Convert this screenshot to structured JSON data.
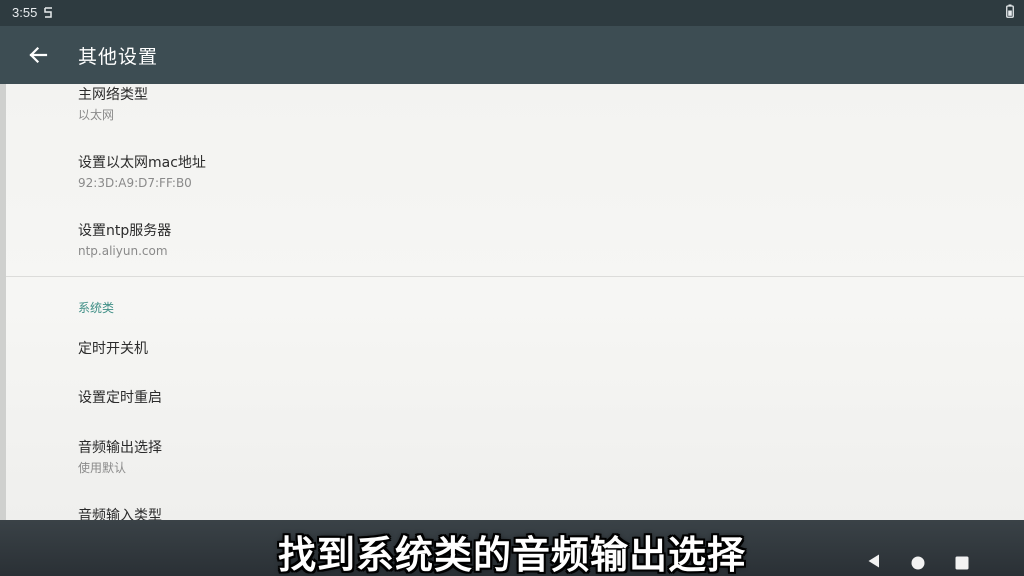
{
  "status_bar": {
    "time": "3:55"
  },
  "toolbar": {
    "title": "其他设置"
  },
  "items": [
    {
      "title": "主网络类型",
      "summary": "以太网"
    },
    {
      "title": "设置以太网mac地址",
      "summary": "92:3D:A9:D7:FF:B0"
    },
    {
      "title": "设置ntp服务器",
      "summary": "ntp.aliyun.com"
    }
  ],
  "category": {
    "label": "系统类"
  },
  "system_items": [
    {
      "title": "定时开关机"
    },
    {
      "title": "设置定时重启"
    },
    {
      "title": "音频输出选择",
      "summary": "使用默认"
    },
    {
      "title": "音频输入类型"
    }
  ],
  "caption": {
    "text": "找到系统类的音频输出选择"
  },
  "colors": {
    "toolbar": "#3d4d53",
    "status_bar": "#2e3b40",
    "accent": "#3f8f86",
    "background": "#f4f4f2"
  },
  "icons": {
    "back": "arrow-left-icon",
    "nav_back": "triangle-left-icon",
    "nav_home": "circle-icon",
    "nav_recents": "square-icon"
  }
}
